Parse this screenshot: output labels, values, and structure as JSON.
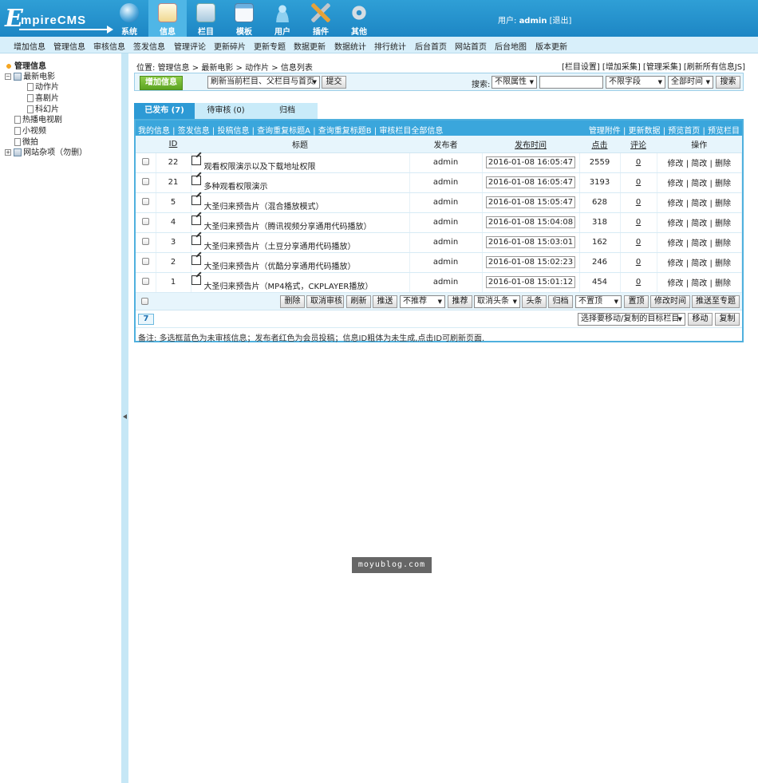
{
  "logo": {
    "big": "E",
    "rest": "mpireCMS"
  },
  "main_nav": [
    {
      "label": "系统",
      "icon": "globe-icon"
    },
    {
      "label": "信息",
      "icon": "document-edit-icon"
    },
    {
      "label": "栏目",
      "icon": "folder-icon"
    },
    {
      "label": "模板",
      "icon": "template-window-icon"
    },
    {
      "label": "用户",
      "icon": "user-icon"
    },
    {
      "label": "插件",
      "icon": "tools-icon"
    },
    {
      "label": "其他",
      "icon": "gear-icon"
    }
  ],
  "user": {
    "prefix": "用户:",
    "name": "admin",
    "logout": "[退出]"
  },
  "sub_nav": [
    "增加信息",
    "管理信息",
    "审核信息",
    "签发信息",
    "管理评论",
    "更新碎片",
    "更新专题",
    "数据更新",
    "数据统计",
    "排行统计",
    "后台首页",
    "网站首页",
    "后台地图",
    "版本更新"
  ],
  "sidebar": {
    "root": "管理信息",
    "items": [
      {
        "label": "最新电影"
      },
      {
        "label": "动作片"
      },
      {
        "label": "喜剧片"
      },
      {
        "label": "科幻片"
      },
      {
        "label": "热播电视剧"
      },
      {
        "label": "小视频"
      },
      {
        "label": "微拍"
      },
      {
        "label": "网站杂项（勿删）"
      }
    ]
  },
  "breadcrumb": {
    "prefix": "位置:",
    "items": [
      "管理信息",
      "最新电影",
      "动作片",
      "信息列表"
    ],
    "sep": ">"
  },
  "right_links": "[栏目设置] [增加采集] [管理采集] [刷新所有信息JS]",
  "toolbar": {
    "add_label": "增加信息",
    "refresh_select": "刷新当前栏目、父栏目与首页",
    "submit": "提交",
    "search_label": "搜索:",
    "attr_select": "不限属性",
    "search_value": "",
    "field_select": "不限字段",
    "time_select": "全部时间",
    "search_button": "搜索"
  },
  "tabs": [
    {
      "label": "已发布 (7)"
    },
    {
      "label": "待审核 (0)"
    },
    {
      "label": "归档"
    }
  ],
  "panel_links_left": "我的信息 | 签发信息 | 投稿信息 | 查询重复标题A | 查询重复标题B | 审核栏目全部信息",
  "panel_links_right": "管理附件 | 更新数据 | 预览首页 | 预览栏目",
  "columns": {
    "id": "ID",
    "title": "标题",
    "publisher": "发布者",
    "time": "发布时间",
    "hits": "点击",
    "comments": "评论",
    "ops": "操作"
  },
  "rows": [
    {
      "id": "22",
      "title": "观看权限演示以及下载地址权限",
      "publisher": "admin",
      "time": "2016-01-08 16:05:47",
      "hits": "2559",
      "comments": "0"
    },
    {
      "id": "21",
      "title": "多种观看权限演示",
      "publisher": "admin",
      "time": "2016-01-08 16:05:47",
      "hits": "3193",
      "comments": "0"
    },
    {
      "id": "5",
      "title": "大圣归来预告片（混合播放模式）",
      "publisher": "admin",
      "time": "2016-01-08 15:05:47",
      "hits": "628",
      "comments": "0"
    },
    {
      "id": "4",
      "title": "大圣归来预告片（腾讯视频分享通用代码播放）",
      "publisher": "admin",
      "time": "2016-01-08 15:04:08",
      "hits": "318",
      "comments": "0"
    },
    {
      "id": "3",
      "title": "大圣归来预告片（土豆分享通用代码播放）",
      "publisher": "admin",
      "time": "2016-01-08 15:03:01",
      "hits": "162",
      "comments": "0"
    },
    {
      "id": "2",
      "title": "大圣归来预告片（优酷分享通用代码播放）",
      "publisher": "admin",
      "time": "2016-01-08 15:02:23",
      "hits": "246",
      "comments": "0"
    },
    {
      "id": "1",
      "title": "大圣归来预告片（MP4格式，CKPLAYER播放）",
      "publisher": "admin",
      "time": "2016-01-08 15:01:12",
      "hits": "454",
      "comments": "0"
    }
  ],
  "row_ops": {
    "edit": "修改",
    "quick_edit": "简改",
    "delete": "删除",
    "sep": "|"
  },
  "actions": {
    "delete": "删除",
    "cancel_review": "取消审核",
    "refresh": "刷新",
    "push": "推送",
    "recommend_select": "不推荐",
    "recommend": "推荐",
    "headline_select": "取消头条",
    "headline": "头条",
    "archive": "归档",
    "top_select": "不置顶",
    "top": "置顶",
    "modify_time": "修改时间",
    "push_topic": "推送至专题"
  },
  "pager": {
    "page": "7"
  },
  "move": {
    "select": "选择要移动/复制的目标栏目",
    "move": "移动",
    "copy": "复制"
  },
  "note": "备注: 多选框蓝色为未审核信息；发布者红色为会员投稿；信息ID粗体为未生成,点击ID可刷新页面.",
  "watermark": "moyublog.com"
}
